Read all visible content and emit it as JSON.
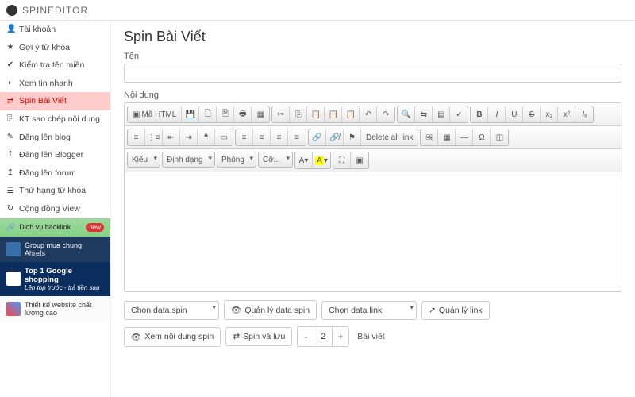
{
  "brand": "SPINEDITOR",
  "sidebar": {
    "items": [
      {
        "icon": "👤",
        "label": "Tài khoản"
      },
      {
        "icon": "★",
        "label": "Gợi ý từ khóa"
      },
      {
        "icon": "✔",
        "label": "Kiểm tra tên miền"
      },
      {
        "icon": "◐",
        "label": "Xem tin nhanh"
      },
      {
        "icon": "⇄",
        "label": "Spin Bài Viết",
        "active": true
      },
      {
        "icon": "⎘",
        "label": "KT sao chép nội dung"
      },
      {
        "icon": "✎",
        "label": "Đăng lên blog"
      },
      {
        "icon": "↥",
        "label": "Đăng lên Blogger"
      },
      {
        "icon": "↥",
        "label": "Đăng lên forum"
      },
      {
        "icon": "☰",
        "label": "Thứ hạng từ khóa"
      },
      {
        "icon": "↻",
        "label": "Cộng đồng View"
      }
    ],
    "backlink": {
      "icon": "🔗",
      "label": "Dịch vụ backlink",
      "badge": "new"
    },
    "ahrefs": "Group mua chung Ahrefs",
    "google": {
      "title": "Top 1 Google shopping",
      "sub": "Lên top trước - trả tiền sau"
    },
    "design": "Thiết kế website chất lượng cao"
  },
  "page": {
    "title": "Spin Bài Viết",
    "name_label": "Tên",
    "content_label": "Nội dung"
  },
  "toolbar": {
    "html": "Mã HTML",
    "delete_all": "Delete all link",
    "style": "Kiểu",
    "format": "Định dạng",
    "font": "Phông",
    "size": "Cỡ...",
    "a": "A",
    "a2": "A"
  },
  "bottom": {
    "spin_data_sel": "Chọn data spin",
    "manage_spin": "Quản lý data spin",
    "link_data_sel": "Chọn data link",
    "manage_link": "Quản lý link",
    "view_spin": "Xem nội dung spin",
    "spin_save": "Spin và lưu",
    "minus": "-",
    "plus": "+",
    "qty": "2",
    "posts": "Bài viết"
  }
}
